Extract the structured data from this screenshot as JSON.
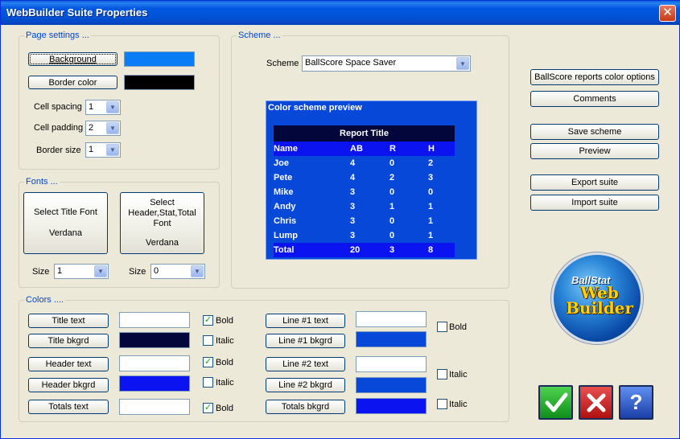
{
  "window": {
    "title": "WebBuilder Suite Properties",
    "close_glyph": "✕"
  },
  "page_settings": {
    "label": "Page settings ...",
    "background_button": "Background",
    "background_color": "#0a7cf5",
    "border_color_button": "Border color",
    "border_color": "#000000",
    "cell_spacing_label": "Cell spacing",
    "cell_spacing_value": "1",
    "cell_padding_label": "Cell padding",
    "cell_padding_value": "2",
    "border_size_label": "Border size",
    "border_size_value": "1"
  },
  "fonts": {
    "label": "Fonts ...",
    "title_font_button": "Select Title Font",
    "title_font_name": "Verdana",
    "header_font_button": "Select Header,Stat,Total Font",
    "header_font_name": "Verdana",
    "size_label": "Size",
    "title_size_value": "1",
    "header_size_value": "0"
  },
  "scheme": {
    "label": "Scheme ...",
    "scheme_label": "Scheme",
    "scheme_value": "BallScore Space Saver",
    "preview_title": "Color scheme preview",
    "report_title": "Report Title",
    "columns": [
      "Name",
      "AB",
      "R",
      "H"
    ],
    "rows": [
      [
        "Joe",
        "4",
        "0",
        "2"
      ],
      [
        "Pete",
        "4",
        "2",
        "3"
      ],
      [
        "Mike",
        "3",
        "0",
        "0"
      ],
      [
        "Andy",
        "3",
        "1",
        "1"
      ],
      [
        "Chris",
        "3",
        "0",
        "1"
      ],
      [
        "Lump",
        "3",
        "0",
        "1"
      ]
    ],
    "total_row": [
      "Total",
      "20",
      "3",
      "8"
    ]
  },
  "side_buttons": {
    "ballscore_colors": "BallScore reports color options",
    "comments": "Comments",
    "save_scheme": "Save scheme",
    "preview": "Preview",
    "export_suite": "Export suite",
    "import_suite": "Import suite"
  },
  "logo": {
    "line1": "BallStat",
    "line2": "Web Builder"
  },
  "colors": {
    "label": "Colors ....",
    "title_text": {
      "button": "Title text",
      "color": "#ffffff"
    },
    "title_bkgrd": {
      "button": "Title bkgrd",
      "color": "#02063a"
    },
    "header_text": {
      "button": "Header text",
      "color": "#ffffff"
    },
    "header_bkgrd": {
      "button": "Header bkgrd",
      "color": "#0b14f0"
    },
    "totals_text": {
      "button": "Totals text",
      "color": "#ffffff"
    },
    "line1_text": {
      "button": "Line #1 text",
      "color": "#ffffff"
    },
    "line1_bkgrd": {
      "button": "Line #1 bkgrd",
      "color": "#0848d8"
    },
    "line2_text": {
      "button": "Line #2 text",
      "color": "#ffffff"
    },
    "line2_bkgrd": {
      "button": "Line #2 bkgrd",
      "color": "#0848d8"
    },
    "totals_bkgrd": {
      "button": "Totals bkgrd",
      "color": "#0b14f0"
    },
    "bold_label": "Bold",
    "italic_label": "Italic",
    "title_bold_checked": true,
    "title_italic_checked": false,
    "header_bold_checked": true,
    "header_italic_checked": false,
    "totals_bold_checked": true,
    "line_bold_checked": false,
    "line_italic1_checked": false,
    "line_italic2_checked": false
  },
  "dialog_buttons": {
    "ok_icon": "check-icon",
    "cancel_icon": "x-icon",
    "help_glyph": "?"
  }
}
